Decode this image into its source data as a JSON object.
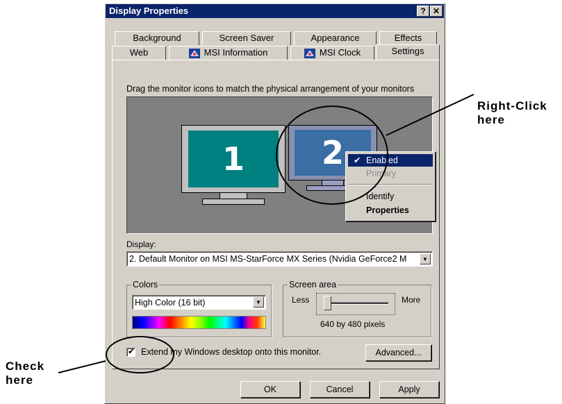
{
  "window": {
    "title": "Display Properties",
    "help_label": "?",
    "close_label": "✕"
  },
  "tabs": {
    "row1": [
      "Background",
      "Screen Saver",
      "Appearance",
      "Effects"
    ],
    "row2": [
      "Web",
      "MSI Information",
      "MSI Clock",
      "Settings"
    ],
    "active": "Settings",
    "icon": "msi-app-icon"
  },
  "settings": {
    "instruction": "Drag the monitor icons to match the physical arrangement of your monitors",
    "monitors": [
      {
        "number": "1",
        "screen_color": "#008080"
      },
      {
        "number": "2",
        "screen_color": "#3a6ea5"
      }
    ],
    "context_menu": {
      "items": [
        {
          "label": "Enabled",
          "checked": true,
          "highlighted": true,
          "disabled": false,
          "bold": false
        },
        {
          "label": "Primary",
          "checked": false,
          "highlighted": false,
          "disabled": true,
          "bold": false
        },
        {
          "label": "Identify",
          "checked": false,
          "highlighted": false,
          "disabled": false,
          "bold": false
        },
        {
          "label": "Properties",
          "checked": false,
          "highlighted": false,
          "disabled": false,
          "bold": true
        }
      ],
      "check_icon": "checkmark-icon"
    },
    "display_label": "Display:",
    "display_value": "2. Default Monitor on MSI MS-StarForce MX Series (Nvidia GeForce2 M",
    "colors": {
      "label": "Colors",
      "value": "High Color (16 bit)"
    },
    "screen_area": {
      "label": "Screen area",
      "less": "Less",
      "more": "More",
      "value_text": "640 by 480 pixels",
      "slider_level": 0
    },
    "extend": {
      "checked": true,
      "label": "Extend my Windows desktop onto this monitor."
    },
    "advanced_button": "Advanced..."
  },
  "footer": {
    "ok": "OK",
    "cancel": "Cancel",
    "apply": "Apply"
  },
  "annotations": {
    "right_click": [
      "Right-Click",
      "here"
    ],
    "check": [
      "Check",
      "here"
    ]
  },
  "colors": {
    "titlebar": "#0a246a",
    "dialog_face": "#d4d0c8",
    "monitor_area": "#808080",
    "highlight": "#0a246a"
  }
}
